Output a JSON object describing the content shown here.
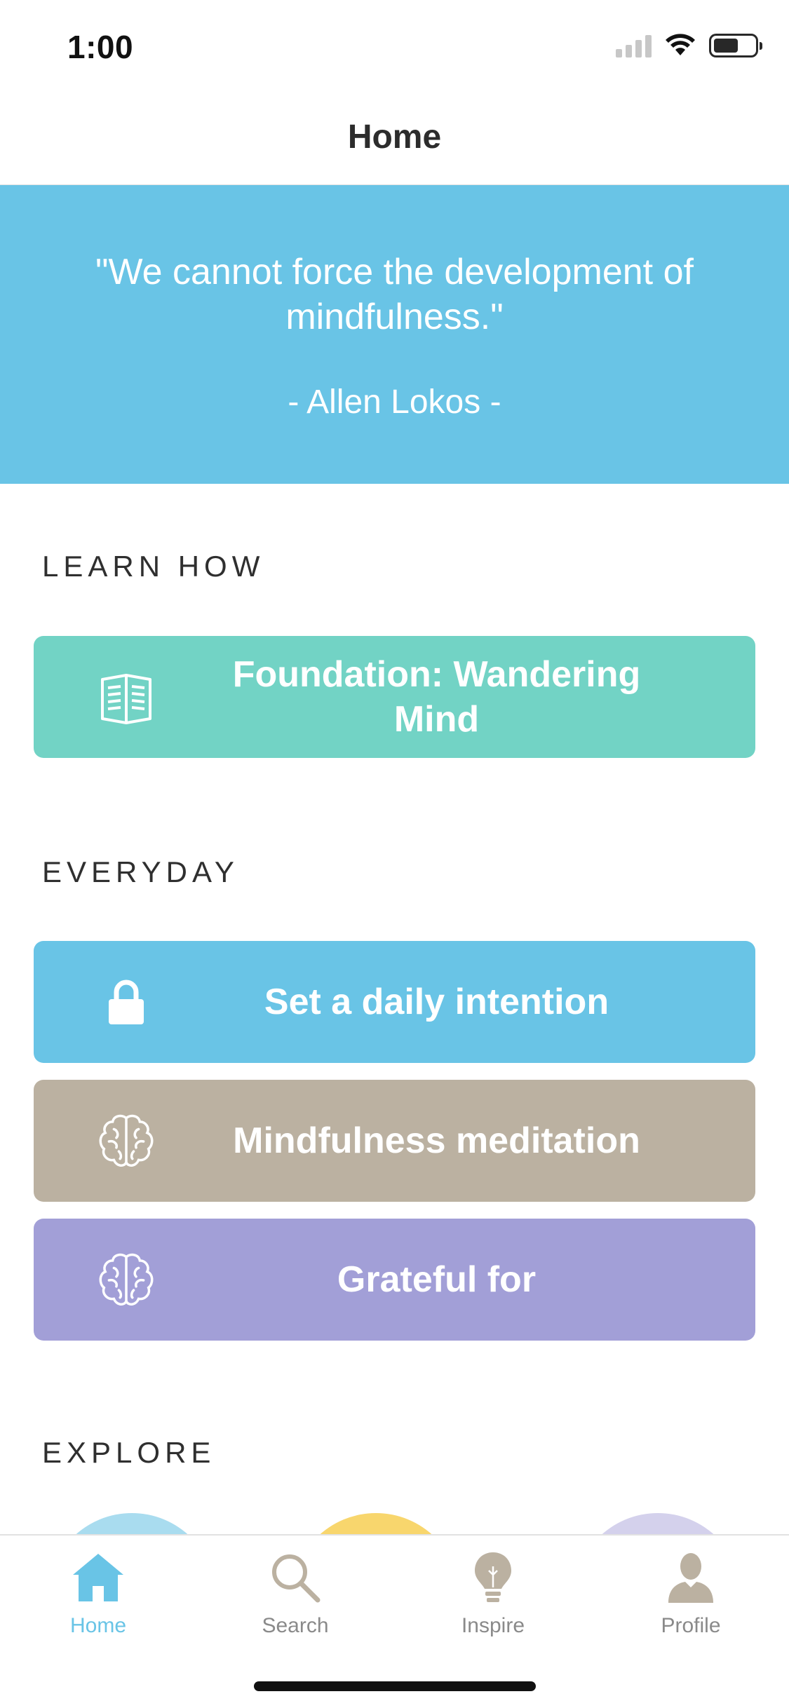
{
  "status_bar": {
    "time": "1:00"
  },
  "nav": {
    "title": "Home"
  },
  "quote": {
    "text": "\"We cannot force the development of mindfulness.\"",
    "author": "- Allen Lokos -"
  },
  "sections": {
    "learn_how": "LEARN HOW",
    "everyday": "EVERYDAY",
    "explore": "EXPLORE"
  },
  "cards": {
    "foundation": {
      "label": "Foundation: Wandering Mind",
      "icon": "book-icon",
      "color": "#72d3c5"
    },
    "intention": {
      "label": "Set a daily intention",
      "icon": "lock-icon",
      "color": "#69c4e6"
    },
    "meditation": {
      "label": "Mindfulness meditation",
      "icon": "brain-icon",
      "color": "#bbb1a1"
    },
    "grateful": {
      "label": "Grateful for",
      "icon": "brain-icon",
      "color": "#a29fd7"
    }
  },
  "explore_colors": [
    "#a9dcef",
    "#f8d66d",
    "#d4d1ec"
  ],
  "tabs": [
    {
      "label": "Home",
      "icon": "home-icon",
      "active": true
    },
    {
      "label": "Search",
      "icon": "search-icon",
      "active": false
    },
    {
      "label": "Inspire",
      "icon": "lightbulb-icon",
      "active": false
    },
    {
      "label": "Profile",
      "icon": "person-icon",
      "active": false
    }
  ],
  "colors": {
    "accent": "#69c4e6",
    "inactive_icon": "#bbb1a1",
    "inactive_label": "#8a8a8a"
  }
}
